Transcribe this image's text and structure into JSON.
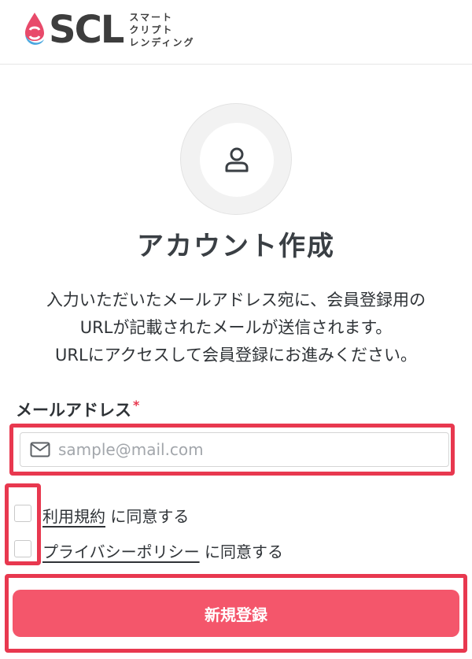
{
  "header": {
    "logo_text": "SCL",
    "logo_sub": [
      "スマート",
      "クリプト",
      "レンディング"
    ]
  },
  "page": {
    "title": "アカウント作成",
    "description": [
      "入力いただいたメールアドレス宛に、会員登録用の",
      "URLが記載されたメールが送信されます。",
      "URLにアクセスして会員登録にお進みください。"
    ]
  },
  "form": {
    "email_label": "メールアドレス",
    "required_mark": "*",
    "email_placeholder": "sample@mail.com",
    "email_value": "",
    "terms_link": "利用規約",
    "terms_suffix": " に同意する",
    "privacy_link": "プライバシーポリシー",
    "privacy_suffix": " に同意する",
    "submit_label": "新規登録"
  },
  "icons": {
    "avatar": "user-icon",
    "email": "mail-icon"
  },
  "colors": {
    "accent": "#f4566b",
    "highlight": "#e8384f",
    "logo_pink": "#e84a6a",
    "logo_blue": "#4aa8e0"
  }
}
